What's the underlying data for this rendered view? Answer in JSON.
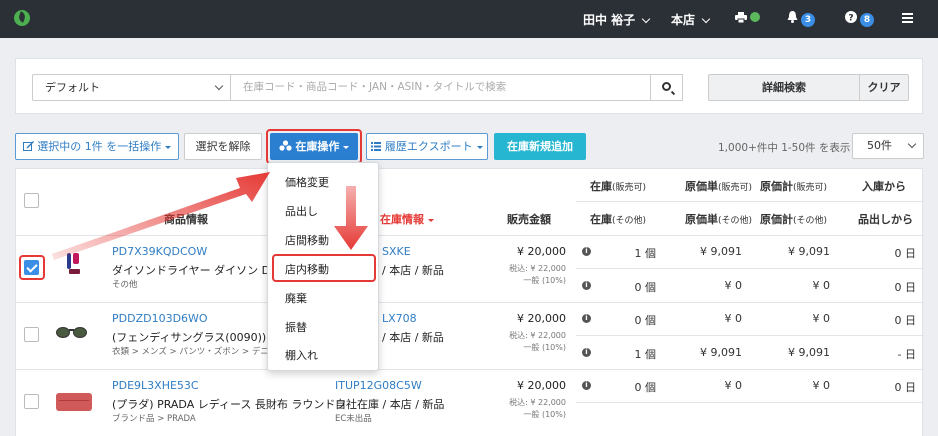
{
  "topbar": {
    "user_name": "田中 裕子",
    "store": "本店",
    "notifications_count": "3",
    "help_count": "8",
    "icons": [
      "logo-icon",
      "printer-icon",
      "bell-icon",
      "question-icon",
      "menu-icon"
    ]
  },
  "search": {
    "preset_value": "デフォルト",
    "placeholder": "在庫コード・商品コード・JAN・ASIN・タイトルで検索",
    "advanced_label": "詳細検索",
    "clear_label": "クリア"
  },
  "toolbar": {
    "bulk_edit_label": "選択中の 1件 を一括操作",
    "deselect_label": "選択を解除",
    "stock_ops_label": "在庫操作",
    "history_export_label": "履歴エクスポート",
    "new_stock_label": "在庫新規追加",
    "count_text": "1,000+件中 1-50件 を表示",
    "per_page_value": "50件"
  },
  "dropdown": {
    "items": [
      "価格変更",
      "品出し",
      "店間移動",
      "店内移動",
      "廃棄",
      "振替",
      "棚入れ"
    ],
    "highlighted": "店内移動"
  },
  "table": {
    "headers": {
      "product_info": "商品情報",
      "stock_info": "在庫情報",
      "sale_price": "販売金額",
      "stock_top": "在庫",
      "stock_top_sub": "(販売可)",
      "stock_bottom": "在庫",
      "stock_bottom_sub": "(その他)",
      "unit_cost_top": "原価単",
      "unit_cost_top_sub": "(販売可)",
      "unit_cost_bottom": "原価単",
      "unit_cost_bottom_sub": "(その他)",
      "total_cost_top": "原価計",
      "total_cost_top_sub": "(販売可)",
      "total_cost_bottom": "原価計",
      "total_cost_bottom_sub": "(その他)",
      "arrival_top": "入庫から",
      "arrival_bottom": "品出しから"
    },
    "rows": [
      {
        "checked": true,
        "code": "PD7X39KQDCOW",
        "name": "ダイソンドライヤー ダイソン Dyson Su",
        "category": "その他",
        "stock_code": "SXKE",
        "stock_location": "/ 本店 / 新品",
        "stock_note": "",
        "price": "¥ 20,000",
        "tax_incl": "税込: ¥ 22,000",
        "tax_type": "一般 (10%)",
        "sellable": {
          "qty": "1 個",
          "unit_cost": "¥ 9,091",
          "total_cost": "¥ 9,091",
          "days": "0 日"
        },
        "other": {
          "qty": "0 個",
          "unit_cost": "¥ 0",
          "total_cost": "¥ 0",
          "days": "0 日"
        }
      },
      {
        "checked": false,
        "code": "PDDZD103D6WO",
        "name": "(フェンディサングラス(0090))FENDI",
        "category": "衣類 > メンズ > パンツ・ズボン > デニムパンツ",
        "stock_code": "LX708",
        "stock_location": "/ 本店 / 新品",
        "stock_note": "",
        "price": "¥ 20,000",
        "tax_incl": "税込: ¥ 22,000",
        "tax_type": "一般 (10%)",
        "sellable": {
          "qty": "0 個",
          "unit_cost": "¥ 0",
          "total_cost": "¥ 0",
          "days": "0 日"
        },
        "other": {
          "qty": "1 個",
          "unit_cost": "¥ 9,091",
          "total_cost": "¥ 9,091",
          "days": "- 日"
        }
      },
      {
        "checked": false,
        "code": "PDE9L3XHE53C",
        "name": "(プラダ) PRADA レディース 長財布 ラウンドフ",
        "category": "ブランド品 > PRADA",
        "stock_code": "ITUP12G08C5W",
        "stock_location": "自社在庫 / 本店 / 新品",
        "stock_note": "EC未出品",
        "price": "¥ 20,000",
        "tax_incl": "税込: ¥ 22,000",
        "tax_type": "一般 (10%)",
        "sellable": {
          "qty": "0 個",
          "unit_cost": "¥ 0",
          "total_cost": "¥ 0",
          "days": "0 日"
        },
        "other": {
          "qty": "",
          "unit_cost": "",
          "total_cost": "",
          "days": ""
        }
      }
    ]
  },
  "colors": {
    "topbar": "#2b2f36",
    "primary": "#2b7fd0",
    "cyan": "#26b6d1",
    "link": "#2f7dc4",
    "annotation_red": "#e53935"
  }
}
